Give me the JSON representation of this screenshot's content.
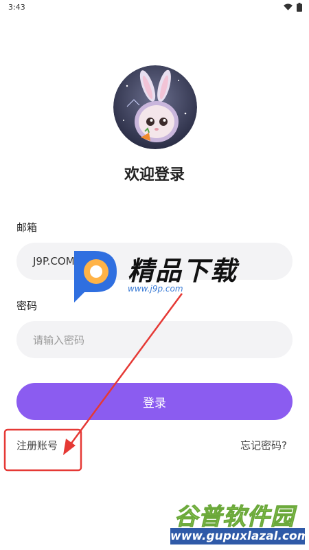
{
  "status_bar": {
    "time": "3:43",
    "icons": [
      "wifi-icon",
      "battery-icon"
    ]
  },
  "header": {
    "title": "欢迎登录"
  },
  "form": {
    "email_label": "邮箱",
    "email_value": "J9P.COM",
    "password_label": "密码",
    "password_placeholder": "请输入密码",
    "login_label": "登录"
  },
  "links": {
    "register": "注册账号",
    "forgot_password": "忘记密码?"
  },
  "overlay": {
    "watermark_title": "精品下载",
    "watermark_url": "www.j9p.com",
    "bottom_watermark_title": "谷普软件园",
    "bottom_watermark_url": "www.gupuxlazal.com"
  },
  "colors": {
    "accent": "#8b5cf0",
    "input_bg": "#f3f3f5",
    "annotation": "#e53935"
  }
}
